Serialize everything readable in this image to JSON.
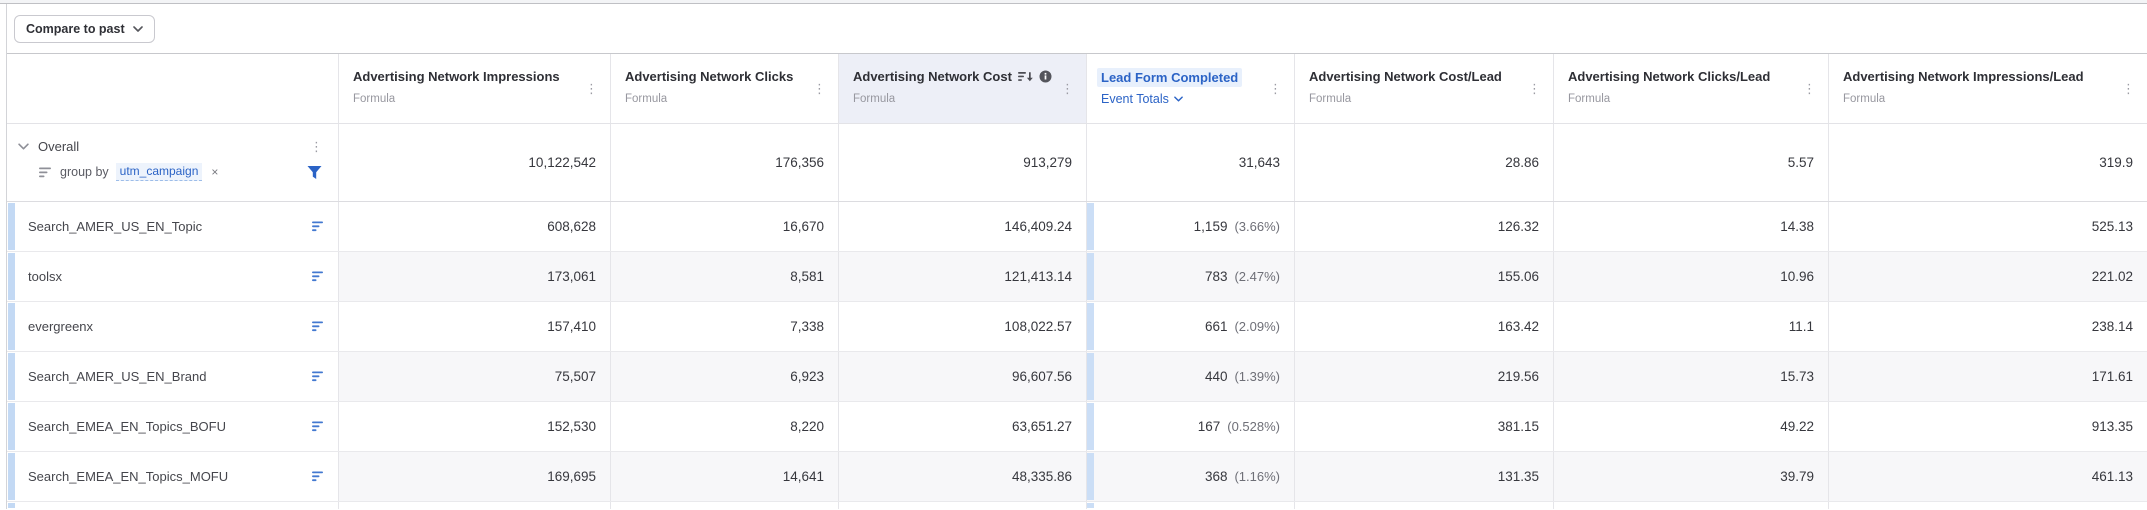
{
  "toolbar": {
    "compare_button_label": "Compare to past"
  },
  "icons": {
    "kebab": "⋮",
    "close": "×"
  },
  "colors": {
    "accent_blue": "#2b63c6",
    "strip_blue": "#c3d9f4",
    "sorted_header_bg": "#edeff7",
    "alt_row_bg": "#f7f7f9"
  },
  "table": {
    "columns": [
      {
        "title": "Advertising Network Impressions",
        "subtitle": "Formula"
      },
      {
        "title": "Advertising Network Clicks",
        "subtitle": "Formula"
      },
      {
        "title": "Advertising Network Cost",
        "subtitle": "Formula",
        "sorted": "descending",
        "has_info_icon": true
      },
      {
        "title": "Lead Form Completed",
        "subtitle": "Event Totals",
        "type": "event"
      },
      {
        "title": "Advertising Network Cost/Lead",
        "subtitle": "Formula"
      },
      {
        "title": "Advertising Network Clicks/Lead",
        "subtitle": "Formula"
      },
      {
        "title": "Advertising Network Impressions/Lead",
        "subtitle": "Formula"
      }
    ],
    "overall": {
      "label": "Overall",
      "group_by_text": "group by",
      "group_by_chip": "utm_campaign",
      "values": {
        "impressions": "10,122,542",
        "clicks": "176,356",
        "cost": "913,279",
        "leads": "31,643",
        "leads_pct": "",
        "cost_per_lead": "28.86",
        "clicks_per_lead": "5.57",
        "impressions_per_lead": "319.9"
      }
    },
    "rows": [
      {
        "name": "Search_AMER_US_EN_Topic",
        "impressions": "608,628",
        "clicks": "16,670",
        "cost": "146,409.24",
        "leads": "1,159",
        "leads_pct": "(3.66%)",
        "cost_per_lead": "126.32",
        "clicks_per_lead": "14.38",
        "impressions_per_lead": "525.13"
      },
      {
        "name": "toolsx",
        "impressions": "173,061",
        "clicks": "8,581",
        "cost": "121,413.14",
        "leads": "783",
        "leads_pct": "(2.47%)",
        "cost_per_lead": "155.06",
        "clicks_per_lead": "10.96",
        "impressions_per_lead": "221.02"
      },
      {
        "name": "evergreenx",
        "impressions": "157,410",
        "clicks": "7,338",
        "cost": "108,022.57",
        "leads": "661",
        "leads_pct": "(2.09%)",
        "cost_per_lead": "163.42",
        "clicks_per_lead": "11.1",
        "impressions_per_lead": "238.14"
      },
      {
        "name": "Search_AMER_US_EN_Brand",
        "impressions": "75,507",
        "clicks": "6,923",
        "cost": "96,607.56",
        "leads": "440",
        "leads_pct": "(1.39%)",
        "cost_per_lead": "219.56",
        "clicks_per_lead": "15.73",
        "impressions_per_lead": "171.61"
      },
      {
        "name": "Search_EMEA_EN_Topics_BOFU",
        "impressions": "152,530",
        "clicks": "8,220",
        "cost": "63,651.27",
        "leads": "167",
        "leads_pct": "(0.528%)",
        "cost_per_lead": "381.15",
        "clicks_per_lead": "49.22",
        "impressions_per_lead": "913.35"
      },
      {
        "name": "Search_EMEA_EN_Topics_MOFU",
        "impressions": "169,695",
        "clicks": "14,641",
        "cost": "48,335.86",
        "leads": "368",
        "leads_pct": "(1.16%)",
        "cost_per_lead": "131.35",
        "clicks_per_lead": "39.79",
        "impressions_per_lead": "461.13"
      }
    ]
  }
}
